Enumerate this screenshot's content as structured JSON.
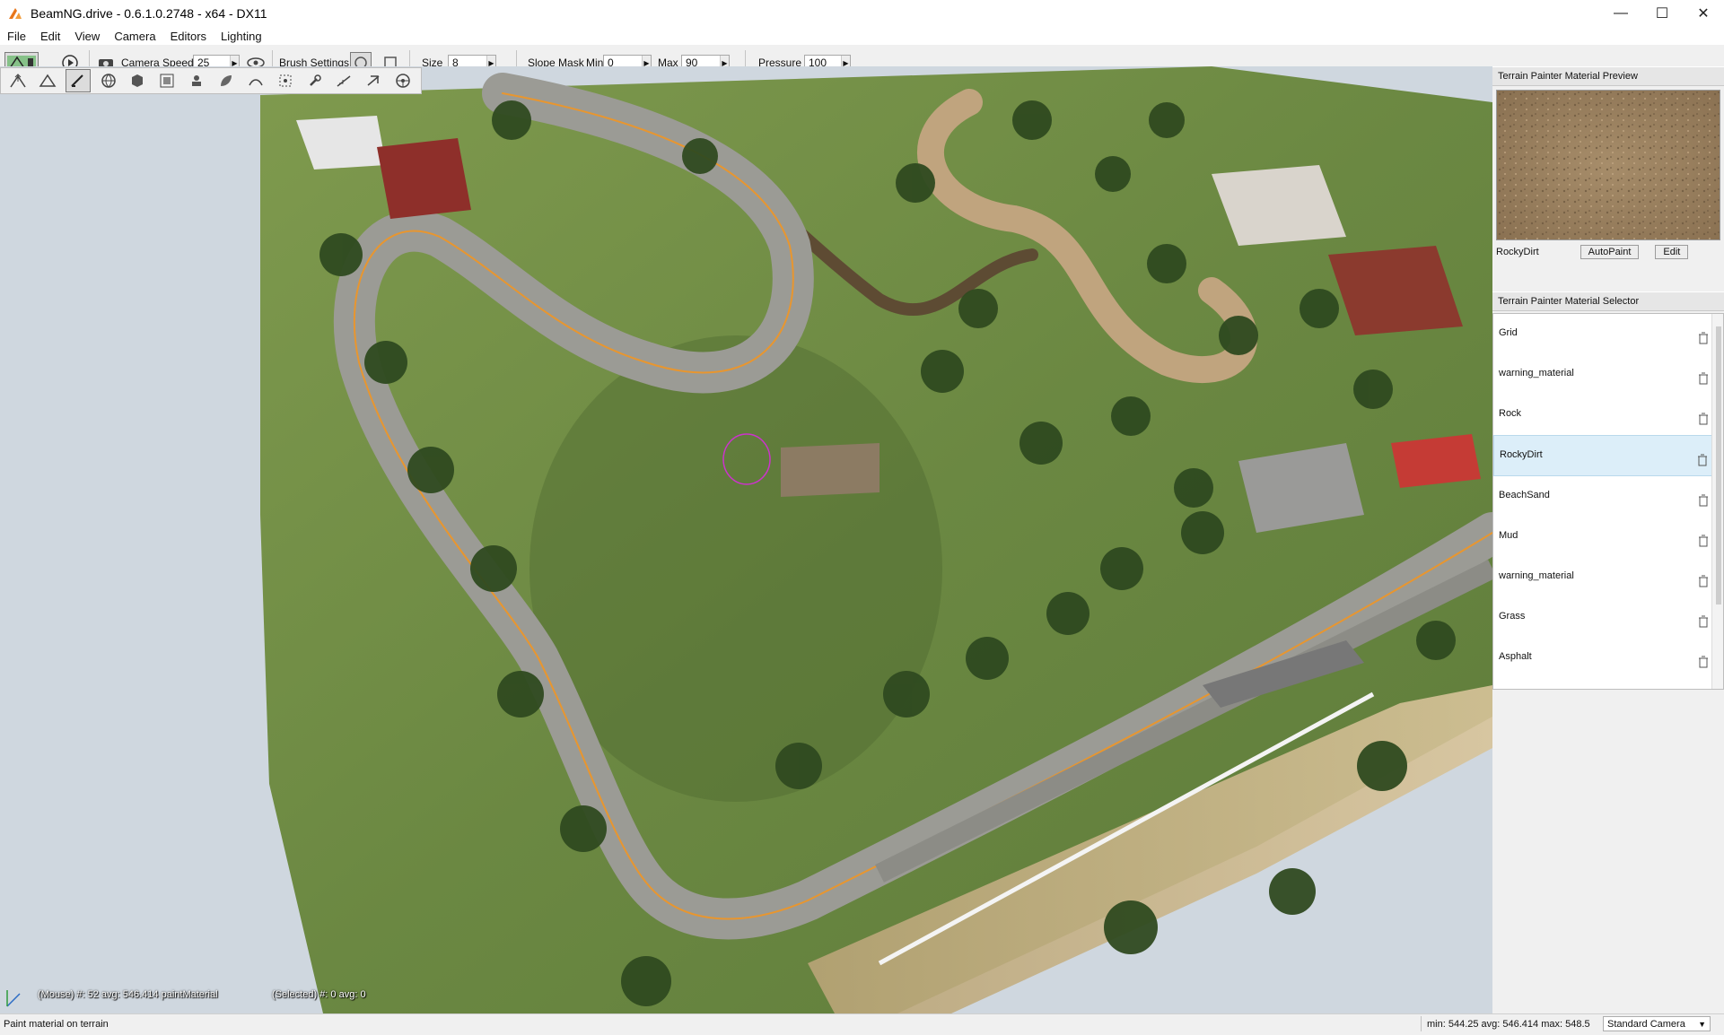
{
  "window": {
    "title": "BeamNG.drive - 0.6.1.0.2748 - x64 - DX11",
    "controls": {
      "minimize": "—",
      "maximize": "☐",
      "close": "✕"
    }
  },
  "menu": [
    "File",
    "Edit",
    "View",
    "Camera",
    "Editors",
    "Lighting"
  ],
  "toolbar": {
    "camera_speed_label": "Camera Speed",
    "camera_speed_value": "25",
    "brush_settings_label": "Brush Settings",
    "size_label": "Size",
    "size_value": "8",
    "slope_mask_label": "Slope Mask",
    "min_label": "Min",
    "min_value": "0",
    "max_label": "Max",
    "max_value": "90",
    "pressure_label": "Pressure",
    "pressure_value": "100"
  },
  "terrain_tools": [
    "raise-height-icon",
    "flatten-icon",
    "paint-material-icon",
    "globe-icon",
    "box-icon",
    "texture-icon",
    "mesh-icon",
    "leaf-icon",
    "smooth-icon",
    "select-icon",
    "wrench-icon",
    "slope-icon",
    "adjust-icon",
    "steering-icon"
  ],
  "viewport": {
    "mouse_info": "(Mouse) #: 52  avg: 546.414  paintMaterial",
    "selected_info": "(Selected) #: 0  avg: 0"
  },
  "preview_panel": {
    "title": "Terrain Painter Material Preview",
    "material_name": "RockyDirt",
    "autopaint_label": "AutoPaint",
    "edit_label": "Edit"
  },
  "selector_panel": {
    "title": "Terrain Painter Material Selector",
    "materials": [
      "Grid",
      "warning_material",
      "Rock",
      "RockyDirt",
      "BeachSand",
      "Mud",
      "warning_material",
      "Grass",
      "Asphalt"
    ],
    "selected": "RockyDirt"
  },
  "status": {
    "message": "Paint material on terrain",
    "stats": "min: 544.25  avg: 546.414  max: 548.5",
    "camera_mode": "Standard Camera"
  },
  "colors": {
    "grass": "#6f8c43",
    "road": "#9b9b95",
    "road_line": "#e8962f",
    "background": "#cfd7df",
    "selection": "#dceef9",
    "brush": "#cc33cc"
  }
}
